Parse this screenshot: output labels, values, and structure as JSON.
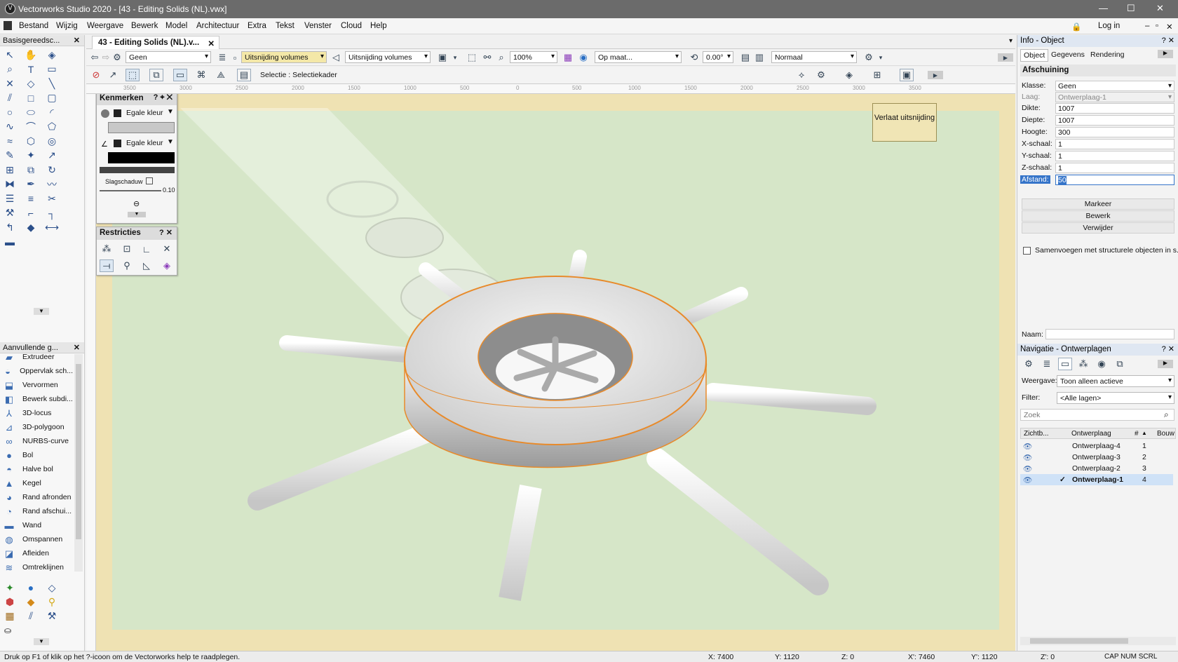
{
  "app": {
    "title": "Vectorworks Studio 2020 - [43 - Editing Solids (NL).vwx]",
    "menu": [
      "Bestand",
      "Wijzig",
      "Weergave",
      "Bewerk",
      "Model",
      "Architectuur",
      "Extra",
      "Tekst",
      "Venster",
      "Cloud",
      "Help"
    ],
    "login_label": "Log in"
  },
  "doc_tab": {
    "label": "43 - Editing Solids (NL).v..."
  },
  "left_tools": {
    "title": "Basisgereedsc..."
  },
  "left_ext": {
    "title": "Aanvullende g...",
    "items": [
      "Extrudeer",
      "Oppervlak sch...",
      "Vervormen",
      "Bewerk subdi...",
      "3D-locus",
      "3D-polygoon",
      "NURBS-curve",
      "Bol",
      "Halve bol",
      "Kegel",
      "Rand afronden",
      "Rand afschui...",
      "Wand",
      "Omspannen",
      "Afleiden",
      "Omtreklijnen"
    ]
  },
  "view_bar": {
    "class_value": "Geen",
    "layer_value": "Uitsnijding volumes",
    "view_value": "Uitsnijding volumes",
    "zoom_value": "100%",
    "scale_value": "Op maat...",
    "angle_value": "0.00°",
    "render_value": "Normaal"
  },
  "mode_bar": {
    "selection_label": "Selectie : Selectiekader"
  },
  "ruler": {
    "labels": [
      "3500",
      "3000",
      "2500",
      "2000",
      "1500",
      "1000",
      "500",
      "0",
      "500",
      "1000",
      "1500",
      "2000",
      "2500",
      "3000",
      "3500"
    ]
  },
  "canvas": {
    "exit_button": "Verlaat uitsnijding"
  },
  "kenmerken": {
    "title": "Kenmerken",
    "fill_label": "Egale kleur",
    "pen_label": "Egale kleur",
    "shadow_label": "Slagschaduw",
    "line_value": "0.10"
  },
  "restricties": {
    "title": "Restricties"
  },
  "info": {
    "title": "Info - Object",
    "tabs": [
      "Object",
      "Gegevens",
      "Rendering"
    ],
    "section": "Afschuining",
    "fields": [
      {
        "label": "Klasse:",
        "value": "Geen"
      },
      {
        "label": "Laag:",
        "value": "Ontwerplaag-1"
      },
      {
        "label": "Dikte:",
        "value": "1007"
      },
      {
        "label": "Diepte:",
        "value": "1007"
      },
      {
        "label": "Hoogte:",
        "value": "300"
      },
      {
        "label": "X-schaal:",
        "value": "1"
      },
      {
        "label": "Y-schaal:",
        "value": "1"
      },
      {
        "label": "Z-schaal:",
        "value": "1"
      },
      {
        "label": "Afstand:",
        "value": "50"
      }
    ],
    "buttons": [
      "Markeer",
      "Bewerk",
      "Verwijder"
    ],
    "merge_label": "Samenvoegen met structurele objecten in s...",
    "name_label": "Naam:"
  },
  "nav": {
    "title": "Navigatie - Ontwerplagen",
    "view_label": "Weergave:",
    "view_value": "Toon alleen actieve",
    "filter_label": "Filter:",
    "filter_value": "<Alle lagen>",
    "search_placeholder": "Zoek",
    "columns": [
      "Zichtb...",
      "Ontwerplaag",
      "#",
      "Bouw"
    ],
    "rows": [
      {
        "name": "Ontwerplaag-4",
        "num": "1",
        "active": false
      },
      {
        "name": "Ontwerplaag-3",
        "num": "2",
        "active": false
      },
      {
        "name": "Ontwerplaag-2",
        "num": "3",
        "active": false
      },
      {
        "name": "Ontwerplaag-1",
        "num": "4",
        "active": true
      }
    ]
  },
  "status": {
    "help": "Druk op F1 of klik op het ?-icoon om de Vectorworks help te raadplegen.",
    "x1": "X: 7400",
    "y1": "Y: 1120",
    "z1": "Z: 0",
    "x2": "X': 7460",
    "y2": "Y': 1120",
    "z2": "Z': 0",
    "keys": "CAP NUM SCRL"
  },
  "colors": {
    "accent": "#e88a2a",
    "canvas": "#d6e6c8",
    "border": "#efe2b3"
  }
}
